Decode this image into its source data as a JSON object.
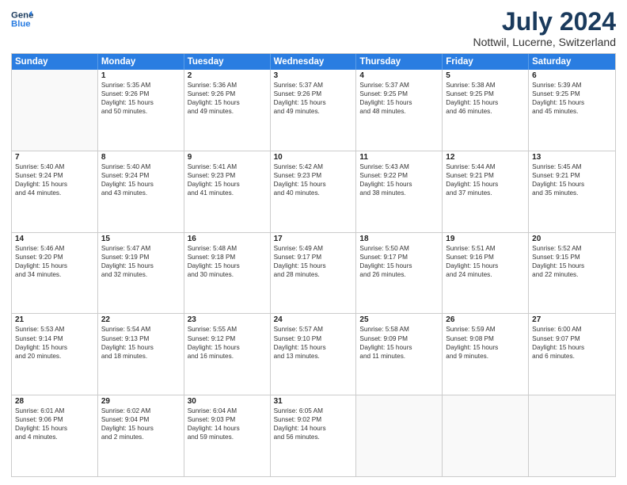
{
  "header": {
    "logo_line1": "General",
    "logo_line2": "Blue",
    "title": "July 2024",
    "subtitle": "Nottwil, Lucerne, Switzerland"
  },
  "weekdays": [
    "Sunday",
    "Monday",
    "Tuesday",
    "Wednesday",
    "Thursday",
    "Friday",
    "Saturday"
  ],
  "rows": [
    [
      {
        "day": "",
        "lines": [],
        "empty": true
      },
      {
        "day": "1",
        "lines": [
          "Sunrise: 5:35 AM",
          "Sunset: 9:26 PM",
          "Daylight: 15 hours",
          "and 50 minutes."
        ]
      },
      {
        "day": "2",
        "lines": [
          "Sunrise: 5:36 AM",
          "Sunset: 9:26 PM",
          "Daylight: 15 hours",
          "and 49 minutes."
        ]
      },
      {
        "day": "3",
        "lines": [
          "Sunrise: 5:37 AM",
          "Sunset: 9:26 PM",
          "Daylight: 15 hours",
          "and 49 minutes."
        ]
      },
      {
        "day": "4",
        "lines": [
          "Sunrise: 5:37 AM",
          "Sunset: 9:25 PM",
          "Daylight: 15 hours",
          "and 48 minutes."
        ]
      },
      {
        "day": "5",
        "lines": [
          "Sunrise: 5:38 AM",
          "Sunset: 9:25 PM",
          "Daylight: 15 hours",
          "and 46 minutes."
        ]
      },
      {
        "day": "6",
        "lines": [
          "Sunrise: 5:39 AM",
          "Sunset: 9:25 PM",
          "Daylight: 15 hours",
          "and 45 minutes."
        ]
      }
    ],
    [
      {
        "day": "7",
        "lines": [
          "Sunrise: 5:40 AM",
          "Sunset: 9:24 PM",
          "Daylight: 15 hours",
          "and 44 minutes."
        ]
      },
      {
        "day": "8",
        "lines": [
          "Sunrise: 5:40 AM",
          "Sunset: 9:24 PM",
          "Daylight: 15 hours",
          "and 43 minutes."
        ]
      },
      {
        "day": "9",
        "lines": [
          "Sunrise: 5:41 AM",
          "Sunset: 9:23 PM",
          "Daylight: 15 hours",
          "and 41 minutes."
        ]
      },
      {
        "day": "10",
        "lines": [
          "Sunrise: 5:42 AM",
          "Sunset: 9:23 PM",
          "Daylight: 15 hours",
          "and 40 minutes."
        ]
      },
      {
        "day": "11",
        "lines": [
          "Sunrise: 5:43 AM",
          "Sunset: 9:22 PM",
          "Daylight: 15 hours",
          "and 38 minutes."
        ]
      },
      {
        "day": "12",
        "lines": [
          "Sunrise: 5:44 AM",
          "Sunset: 9:21 PM",
          "Daylight: 15 hours",
          "and 37 minutes."
        ]
      },
      {
        "day": "13",
        "lines": [
          "Sunrise: 5:45 AM",
          "Sunset: 9:21 PM",
          "Daylight: 15 hours",
          "and 35 minutes."
        ]
      }
    ],
    [
      {
        "day": "14",
        "lines": [
          "Sunrise: 5:46 AM",
          "Sunset: 9:20 PM",
          "Daylight: 15 hours",
          "and 34 minutes."
        ]
      },
      {
        "day": "15",
        "lines": [
          "Sunrise: 5:47 AM",
          "Sunset: 9:19 PM",
          "Daylight: 15 hours",
          "and 32 minutes."
        ]
      },
      {
        "day": "16",
        "lines": [
          "Sunrise: 5:48 AM",
          "Sunset: 9:18 PM",
          "Daylight: 15 hours",
          "and 30 minutes."
        ]
      },
      {
        "day": "17",
        "lines": [
          "Sunrise: 5:49 AM",
          "Sunset: 9:17 PM",
          "Daylight: 15 hours",
          "and 28 minutes."
        ]
      },
      {
        "day": "18",
        "lines": [
          "Sunrise: 5:50 AM",
          "Sunset: 9:17 PM",
          "Daylight: 15 hours",
          "and 26 minutes."
        ]
      },
      {
        "day": "19",
        "lines": [
          "Sunrise: 5:51 AM",
          "Sunset: 9:16 PM",
          "Daylight: 15 hours",
          "and 24 minutes."
        ]
      },
      {
        "day": "20",
        "lines": [
          "Sunrise: 5:52 AM",
          "Sunset: 9:15 PM",
          "Daylight: 15 hours",
          "and 22 minutes."
        ]
      }
    ],
    [
      {
        "day": "21",
        "lines": [
          "Sunrise: 5:53 AM",
          "Sunset: 9:14 PM",
          "Daylight: 15 hours",
          "and 20 minutes."
        ]
      },
      {
        "day": "22",
        "lines": [
          "Sunrise: 5:54 AM",
          "Sunset: 9:13 PM",
          "Daylight: 15 hours",
          "and 18 minutes."
        ]
      },
      {
        "day": "23",
        "lines": [
          "Sunrise: 5:55 AM",
          "Sunset: 9:12 PM",
          "Daylight: 15 hours",
          "and 16 minutes."
        ]
      },
      {
        "day": "24",
        "lines": [
          "Sunrise: 5:57 AM",
          "Sunset: 9:10 PM",
          "Daylight: 15 hours",
          "and 13 minutes."
        ]
      },
      {
        "day": "25",
        "lines": [
          "Sunrise: 5:58 AM",
          "Sunset: 9:09 PM",
          "Daylight: 15 hours",
          "and 11 minutes."
        ]
      },
      {
        "day": "26",
        "lines": [
          "Sunrise: 5:59 AM",
          "Sunset: 9:08 PM",
          "Daylight: 15 hours",
          "and 9 minutes."
        ]
      },
      {
        "day": "27",
        "lines": [
          "Sunrise: 6:00 AM",
          "Sunset: 9:07 PM",
          "Daylight: 15 hours",
          "and 6 minutes."
        ]
      }
    ],
    [
      {
        "day": "28",
        "lines": [
          "Sunrise: 6:01 AM",
          "Sunset: 9:06 PM",
          "Daylight: 15 hours",
          "and 4 minutes."
        ]
      },
      {
        "day": "29",
        "lines": [
          "Sunrise: 6:02 AM",
          "Sunset: 9:04 PM",
          "Daylight: 15 hours",
          "and 2 minutes."
        ]
      },
      {
        "day": "30",
        "lines": [
          "Sunrise: 6:04 AM",
          "Sunset: 9:03 PM",
          "Daylight: 14 hours",
          "and 59 minutes."
        ]
      },
      {
        "day": "31",
        "lines": [
          "Sunrise: 6:05 AM",
          "Sunset: 9:02 PM",
          "Daylight: 14 hours",
          "and 56 minutes."
        ]
      },
      {
        "day": "",
        "lines": [],
        "empty": true
      },
      {
        "day": "",
        "lines": [],
        "empty": true
      },
      {
        "day": "",
        "lines": [],
        "empty": true
      }
    ]
  ]
}
